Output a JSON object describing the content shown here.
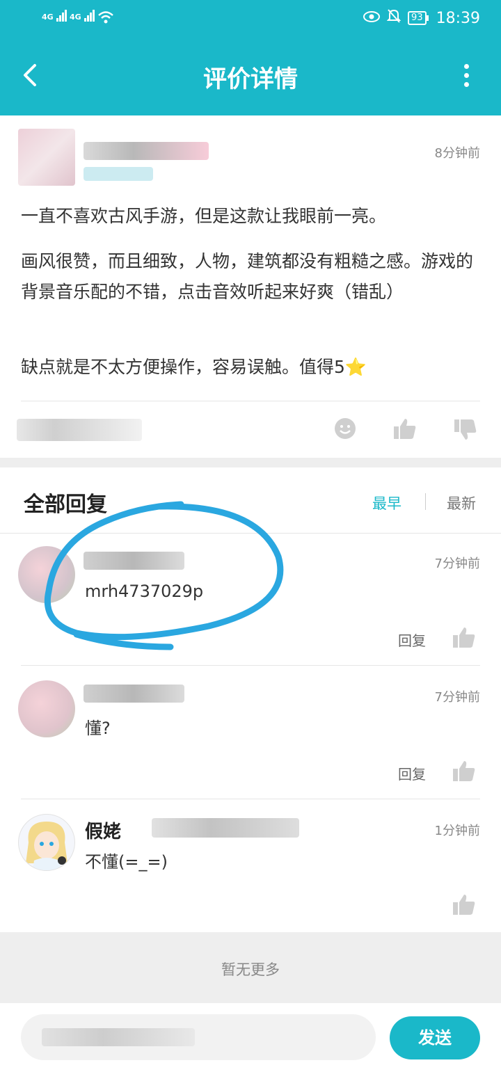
{
  "status": {
    "sim1": "4G",
    "sim2": "4G",
    "battery": "93",
    "time": "18:39"
  },
  "appbar": {
    "title": "评价详情",
    "back_icon": "back-arrow-icon",
    "more_icon": "more-vertical-icon"
  },
  "review": {
    "time": "8分钟前",
    "paragraphs": [
      "一直不喜欢古风手游，但是这款让我眼前一亮。",
      "画风很赞，而且细致，人物，建筑都没有粗糙之感。游戏的背景音乐配的不错，点击音效听起来好爽（错乱）",
      "缺点就是不太方便操作，容易误触。值得5⭐"
    ]
  },
  "replies_section": {
    "title": "全部回复",
    "sort_earliest": "最早",
    "sort_latest": "最新",
    "active_color": "#1ab8c9"
  },
  "replies": [
    {
      "time": "7分钟前",
      "text": "mrh4737029p",
      "reply_label": "回复"
    },
    {
      "time": "7分钟前",
      "text": "懂?",
      "reply_label": "回复"
    },
    {
      "username": "假姥",
      "time": "1分钟前",
      "text": "不懂(=_=)"
    }
  ],
  "footer": {
    "no_more": "暂无更多",
    "send_label": "发送"
  },
  "colors": {
    "accent": "#1ab8c9",
    "annotation": "#2aa7e0"
  }
}
